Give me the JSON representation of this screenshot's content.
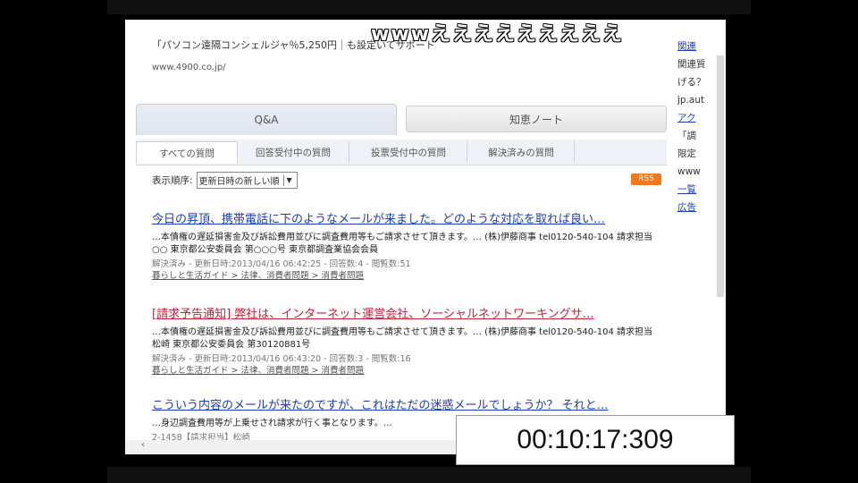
{
  "overlay": {
    "text": "wwwえええええええええ"
  },
  "ad": {
    "text": "「パソコン遠隔コンシェルジャ％5,250円｜も設定いてサポート",
    "url": "www.4900.co.jp/"
  },
  "tabs": {
    "qa": "Q&A",
    "knowledge": "知恵ノート"
  },
  "subtabs": [
    "すべての質問",
    "回答受付中の質問",
    "投票受付中の質問",
    "解決済みの質問"
  ],
  "sort": {
    "label": "表示順序:",
    "value": "更新日時の新しい順"
  },
  "rss": "RSS",
  "questions": [
    {
      "title": "今日の昇頂、携帯電話に下のようなメールが来ました。どのような対応を取れば良い…",
      "body": "…本債権の遅延損害金及び訴訟費用並びに調査費用等もご請求させて頂きます。… (株)伊藤商事 tel0120-540-104 請求担当 ○○ 東京都公安委員会 第○○○号 東京都調査業協会会員",
      "meta": "解決済み - 更新日時:2013/04/16 06:42:25 - 回答数:4 - 閲覧数:51",
      "category": "暮らしと生活ガイド > 法律、消費者問題 > 消費者問題",
      "red": false
    },
    {
      "title": "[請求予告通知] 弊社は、インターネット運営会社、ソーシャルネットワーキングサ…",
      "body": "…本債権の遅延損害金及び訴訟費用並びに調査費用等もご請求させて頂きます。… (株)伊藤商事 tel0120-540-104 請求担当 松崎 東京都公安委員会 第30120881号",
      "meta": "解決済み - 更新日時:2013/04/16 06:43:20 - 回答数:3 - 閲覧数:16",
      "category": "暮らしと生活ガイド > 法律、消費者問題 > 消費者問題",
      "red": true
    },
    {
      "title": "こういう内容のメールが来たのですが、これはただの迷惑メールでしょうか？ それと…",
      "body": "…身辺調査費用等が上乗せされ請求が行く事となります。…",
      "meta": "2-1458【請求担当】松崎",
      "category": "",
      "red": false
    }
  ],
  "sidebar": {
    "items": [
      "関連",
      "関連質",
      "げる？",
      "jp.aut",
      "",
      "アク",
      "「調",
      "限定",
      "www",
      "",
      "一覧",
      "広告"
    ]
  },
  "timer": {
    "value": "00:10:17:309"
  }
}
